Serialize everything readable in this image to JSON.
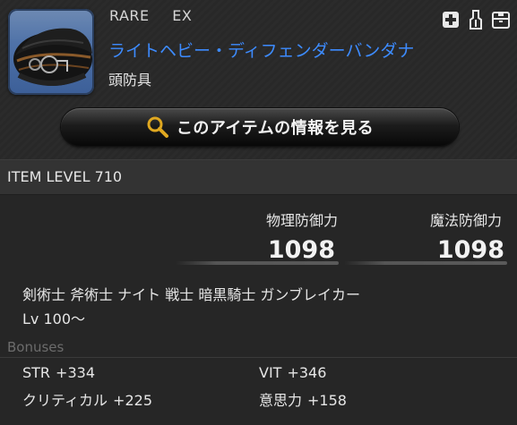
{
  "header": {
    "rarity": "RARE",
    "tradability": "EX",
    "item_name": "ライトヘビー・ディフェンダーバンダナ",
    "category": "頭防具",
    "icons": [
      "add-plus-icon",
      "glamour-dresser-icon",
      "armoire-icon"
    ]
  },
  "search_button": {
    "label": "このアイテムの情報を見る",
    "icon": "magnifier-icon"
  },
  "item_level": {
    "text": "ITEM LEVEL 710"
  },
  "stats": {
    "defense_label": "物理防御力",
    "defense_value": "1098",
    "magic_defense_label": "魔法防御力",
    "magic_defense_value": "1098"
  },
  "requirements": {
    "jobs": "剣術士 斧術士 ナイト 戦士 暗黒騎士 ガンブレイカー",
    "level": "Lv 100～"
  },
  "bonuses": {
    "heading": "Bonuses",
    "items": [
      {
        "name": "STR",
        "value": "+334"
      },
      {
        "name": "VIT",
        "value": "+346"
      },
      {
        "name": "クリティカル",
        "value": "+225"
      },
      {
        "name": "意思力",
        "value": "+158"
      }
    ]
  },
  "colors": {
    "item_name": "#3d8bff",
    "background": "#262626",
    "section_heading": "#6c6c6c"
  }
}
